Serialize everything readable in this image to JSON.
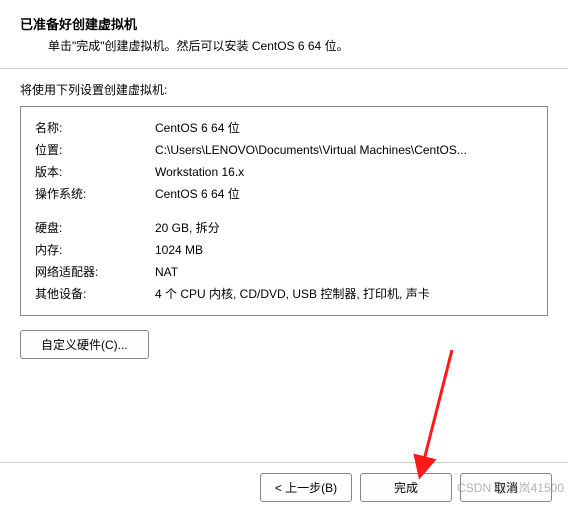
{
  "header": {
    "title": "已准备好创建虚拟机",
    "subtitle": "单击\"完成\"创建虚拟机。然后可以安装 CentOS 6 64 位。"
  },
  "section_label": "将使用下列设置创建虚拟机:",
  "summary": {
    "name_label": "名称:",
    "name_value": "CentOS 6 64 位",
    "location_label": "位置:",
    "location_value": "C:\\Users\\LENOVO\\Documents\\Virtual Machines\\CentOS...",
    "version_label": "版本:",
    "version_value": "Workstation 16.x",
    "os_label": "操作系统:",
    "os_value": "CentOS 6 64 位",
    "disk_label": "硬盘:",
    "disk_value": "20 GB, 拆分",
    "memory_label": "内存:",
    "memory_value": "1024 MB",
    "network_label": "网络适配器:",
    "network_value": "NAT",
    "other_label": "其他设备:",
    "other_value": "4 个 CPU 内核, CD/DVD, USB 控制器, 打印机, 声卡"
  },
  "buttons": {
    "customize": "自定义硬件(C)...",
    "back": "< 上一步(B)",
    "finish": "完成",
    "cancel": "取消"
  },
  "watermark": "CSDN @水岚41500"
}
